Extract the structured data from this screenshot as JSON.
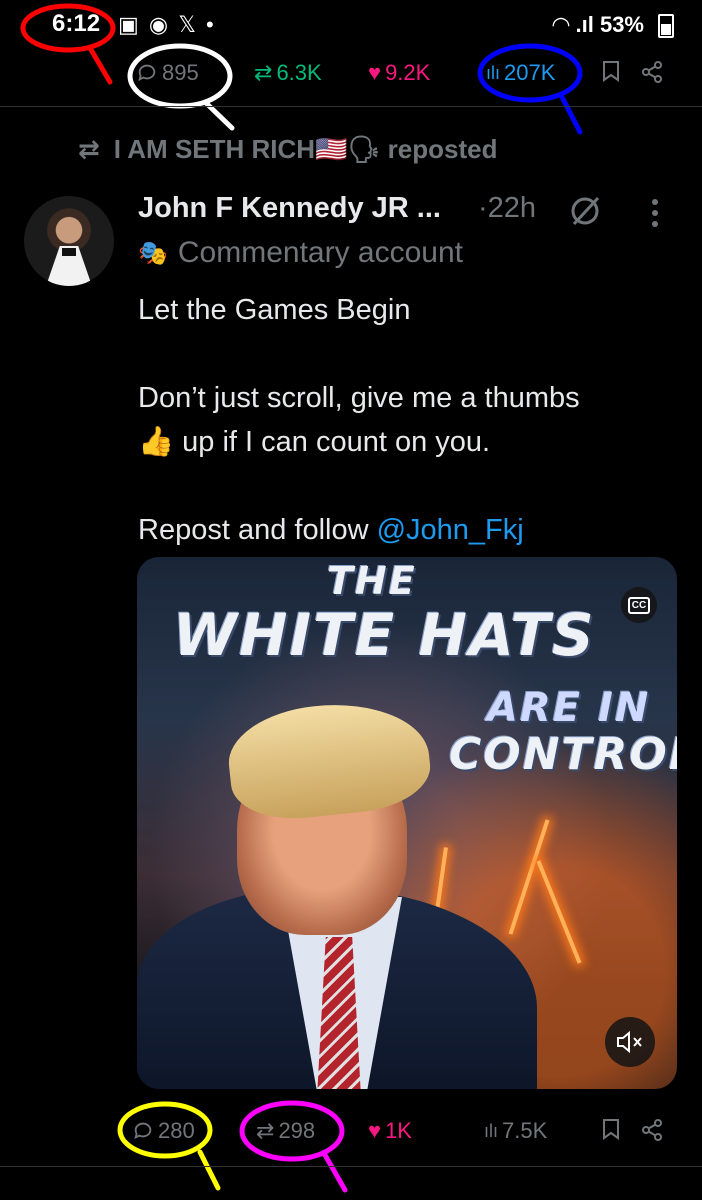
{
  "status_bar": {
    "time": "6:12",
    "battery": "53%"
  },
  "previous_post_actions": {
    "replies": "895",
    "reposts": "6.3K",
    "likes": "9.2K",
    "views": "207K"
  },
  "repost_context": {
    "text": "I AM SETH RICH🇺🇸🗣 reposted"
  },
  "post": {
    "author_name": "John F Kennedy JR ...",
    "time": "·22h",
    "label": "Commentary account",
    "body_lines": [
      "Let the Games Begin",
      "Don’t just scroll, give me a thumbs",
      "👍 up if I can count on you.",
      "Repost and follow "
    ],
    "mention": "@John_Fkj",
    "media": {
      "title_top": "THE",
      "title_main": "WHITE HATS",
      "title_sub1": "ARE IN",
      "title_sub2": "CONTROL",
      "cc_label": "CC"
    },
    "actions": {
      "replies": "280",
      "reposts": "298",
      "likes": "1K",
      "views": "7.5K"
    }
  },
  "colors": {
    "background": "#000000",
    "muted": "#71767b",
    "repost": "#00ba7c",
    "like": "#f91880",
    "link": "#1d9bf0"
  },
  "annotations": [
    {
      "target": "status-time",
      "color": "#ff0000"
    },
    {
      "target": "replies-count-top",
      "color": "#000000"
    },
    {
      "target": "views-count-top",
      "color": "#0000ff"
    },
    {
      "target": "replies-count-bottom",
      "color": "#ffff00"
    },
    {
      "target": "reposts-count-bottom",
      "color": "#ff00ff"
    }
  ]
}
